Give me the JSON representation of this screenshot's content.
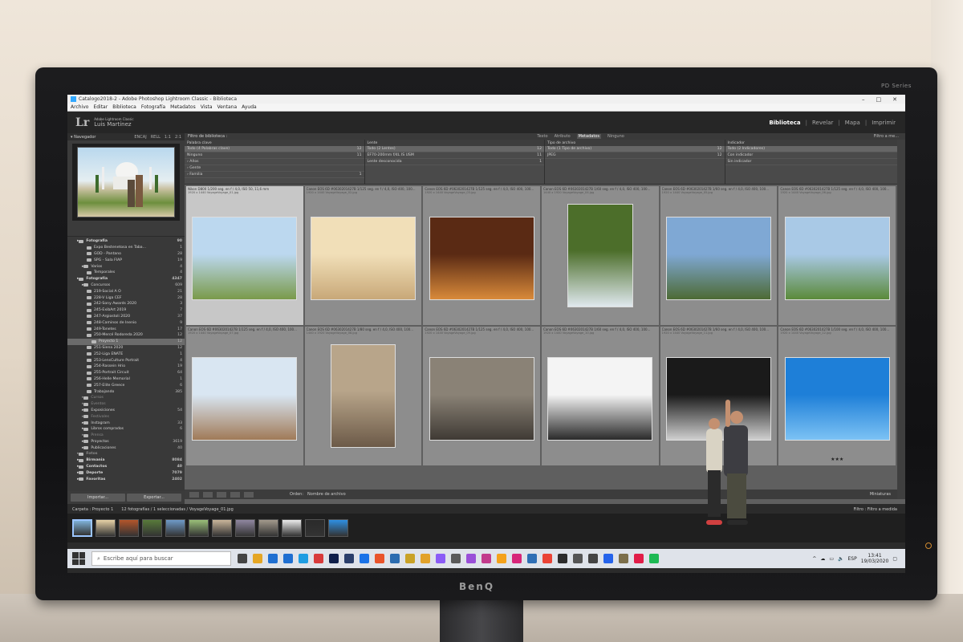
{
  "window": {
    "title": "Catalogo2018-2 - Adobe Photoshop Lightroom Classic - Biblioteca",
    "menus": [
      "Archivo",
      "Editar",
      "Biblioteca",
      "Fotografía",
      "Metadatos",
      "Vista",
      "Ventana",
      "Ayuda"
    ]
  },
  "identity": {
    "app": "Adobe Lightroom Classic",
    "user": "Luis Martínez",
    "logo": "Lr"
  },
  "modules": [
    "Biblioteca",
    "Revelar",
    "Mapa",
    "Imprimir"
  ],
  "navigator": {
    "title": "Navegador",
    "zooms": [
      "ENCAJ",
      "RELL",
      "1:1",
      "2:1"
    ]
  },
  "folders": [
    {
      "name": "Fotografia",
      "count": "90",
      "level": 1
    },
    {
      "name": "Expo Bestenetosa en Taba...",
      "count": "1",
      "level": 3
    },
    {
      "name": "GOD - Pantano",
      "count": "28",
      "level": 3
    },
    {
      "name": "SPG - Sala FIAP",
      "count": "19",
      "level": 3
    },
    {
      "name": "Varios",
      "count": "4",
      "level": 2
    },
    {
      "name": "Temporales",
      "count": "4",
      "level": 3
    },
    {
      "name": "Fotografía",
      "count": "4347",
      "level": 1
    },
    {
      "name": "Concursos",
      "count": "609",
      "level": 2
    },
    {
      "name": "219-Social A O",
      "count": "21",
      "level": 3
    },
    {
      "name": "228-V Liga CEF",
      "count": "28",
      "level": 3
    },
    {
      "name": "242-Sony Awards 2020",
      "count": "3",
      "level": 3
    },
    {
      "name": "245-ExibArt 2019",
      "count": "7",
      "level": 3
    },
    {
      "name": "247-Argiostoli 2020",
      "count": "37",
      "level": 3
    },
    {
      "name": "248-Caminos de Inenio",
      "count": "9",
      "level": 3
    },
    {
      "name": "249-Tonetes",
      "count": "17",
      "level": 3
    },
    {
      "name": "250-Mercé Rodoreda 2020",
      "count": "12",
      "level": 3
    },
    {
      "name": "Proyecto 1",
      "count": "12",
      "level": 4,
      "selected": true
    },
    {
      "name": "251-Siena 2020",
      "count": "12",
      "level": 3
    },
    {
      "name": "252-Liga ENATE",
      "count": "1",
      "level": 3
    },
    {
      "name": "253-LensCulture Portrait",
      "count": "4",
      "level": 3
    },
    {
      "name": "254-Rassein Hrio",
      "count": "19",
      "level": 3
    },
    {
      "name": "255-Portrait Circuit",
      "count": "64",
      "level": 3
    },
    {
      "name": "256-Helle Memorial",
      "count": "1",
      "level": 3
    },
    {
      "name": "257-Elite Greece",
      "count": "6",
      "level": 3
    },
    {
      "name": "Trabajando",
      "count": "385",
      "level": 3
    },
    {
      "name": "Cursos",
      "count": "",
      "level": 2,
      "dim": true
    },
    {
      "name": "Eventos",
      "count": "",
      "level": 2,
      "dim": true
    },
    {
      "name": "Exposiciones",
      "count": "54",
      "level": 2
    },
    {
      "name": "Festivales",
      "count": "",
      "level": 2,
      "dim": true
    },
    {
      "name": "Instagram",
      "count": "33",
      "level": 2
    },
    {
      "name": "Libros comprados",
      "count": "6",
      "level": 2
    },
    {
      "name": "Prensa",
      "count": "",
      "level": 2,
      "dim": true
    },
    {
      "name": "Proyectos",
      "count": "3619",
      "level": 2
    },
    {
      "name": "Publicaciones",
      "count": "40",
      "level": 2
    },
    {
      "name": "Fotos",
      "count": "",
      "level": 1,
      "dim": true
    },
    {
      "name": "Birmania",
      "count": "8084",
      "level": 1
    },
    {
      "name": "Contactos",
      "count": "40",
      "level": 1
    },
    {
      "name": "Deporte",
      "count": "7079",
      "level": 1
    },
    {
      "name": "Favoritas",
      "count": "2402",
      "level": 1
    }
  ],
  "left_buttons": {
    "import": "Importar...",
    "export": "Exportar..."
  },
  "filter": {
    "title": "Filtro de biblioteca :",
    "tabs": [
      "Texto",
      "Atributo",
      "Metadatos",
      "Ninguno"
    ],
    "preset": "Filtro a me...",
    "columns": [
      {
        "header": "Palabra clave",
        "rows": [
          {
            "label": "Todo (4 Palabras clave)",
            "value": "12",
            "hl": true
          },
          {
            "label": "Ninguno",
            "value": "11"
          },
          {
            "label": "› Años",
            "value": ""
          },
          {
            "label": "› Gente",
            "value": ""
          },
          {
            "label": "  › Familia",
            "value": "1"
          }
        ]
      },
      {
        "header": "Lente",
        "rows": [
          {
            "label": "Todo (2 Lentes)",
            "value": "12",
            "hl": true
          },
          {
            "label": "EF70-200mm f/4L IS USM",
            "value": "11"
          },
          {
            "label": "Lente desconocida",
            "value": "1"
          }
        ]
      },
      {
        "header": "Tipo de archivo",
        "rows": [
          {
            "label": "Todo (1 Tipo de archivo)",
            "value": "12",
            "hl": true
          },
          {
            "label": "JPEG",
            "value": "12"
          }
        ]
      },
      {
        "header": "Indicador",
        "rows": [
          {
            "label": "Todo (2 Indicadores)",
            "value": "12",
            "hl": true
          },
          {
            "label": "Con indicador",
            "value": "0"
          },
          {
            "label": "Sin indicador",
            "value": "12"
          }
        ]
      }
    ]
  },
  "grid": [
    {
      "cap": "Nikon D800    1/200 seg. en f / 4,0, ISO 50, 11,6 mm",
      "file": "1920 x 1440    VoyageVoyage_01.jpg",
      "sel": true,
      "c1": "#bcd8ef",
      "c2": "#7a9a4a",
      "stars": ""
    },
    {
      "cap": "Canon EOS 6D #0630201427B   1/125 seg. en f / 4,0, ISO 400, 100...",
      "file": "1920 x 1440    VoyageVoyage_02.jpg",
      "c1": "#f1dfb8",
      "c2": "#c8a878",
      "stars": ""
    },
    {
      "cap": "Canon EOS 6D #0630201427B   1/125 seg. en f / 4,0, ISO 400, 100...",
      "file": "1920 x 1440    VoyageVoyage_03.jpg",
      "c1": "#5a2a14",
      "c2": "#d98a3a",
      "stars": ""
    },
    {
      "cap": "Canon EOS 6D #0630201427B   1/60 seg. en f / 4,0, ISO 400, 100...",
      "file": "1440 x 1920    VoyageVoyage_04.jpg",
      "c1": "#4c6e2a",
      "c2": "#dfe8ee",
      "stars": ""
    },
    {
      "cap": "Canon EOS 6D #0630201427B   1/60 seg. en f / 4,0, ISO 400, 100...",
      "file": "1920 x 1440    VoyageVoyage_05.jpg",
      "c1": "#7fa8d4",
      "c2": "#4d6a34",
      "stars": ""
    },
    {
      "cap": "Canon EOS 6D #0630201427B   1/125 seg. en f / 4,0, ISO 400, 100...",
      "file": "1920 x 1440    VoyageVoyage_06.jpg",
      "c1": "#a9c9e6",
      "c2": "#5b8a3a",
      "stars": ""
    },
    {
      "cap": "Canon EOS 6D #0630201427B   1/125 seg. en f / 4,0, ISO 400, 100...",
      "file": "1920 x 1440    VoyageVoyage_07.jpg",
      "c1": "#d9e6f2",
      "c2": "#a07a58",
      "stars": ""
    },
    {
      "cap": "Canon EOS 6D #0630201427B   1/80 seg. en f / 4,0, ISO 400, 100...",
      "file": "1440 x 1920    VoyageVoyage_08.jpg",
      "c1": "#b8a58a",
      "c2": "#6c5a48",
      "stars": ""
    },
    {
      "cap": "Canon EOS 6D #0630201427B   1/125 seg. en f / 4,0, ISO 400, 100...",
      "file": "1920 x 1440    VoyageVoyage_09.jpg",
      "c1": "#8a8276",
      "c2": "#3f3a34",
      "stars": ""
    },
    {
      "cap": "Canon EOS 6D #0630201427B   1/60 seg. en f / 4,0, ISO 400, 100...",
      "file": "1920 x 1440    VoyageVoyage_10.jpg",
      "c1": "#f4f4f4",
      "c2": "#2a2a2a",
      "stars": ""
    },
    {
      "cap": "Canon EOS 6D #0630201427B   1/60 seg. en f / 4,0, ISO 400, 100...",
      "file": "1920 x 1440    VoyageVoyage_11.jpg",
      "c1": "#1a1a1a",
      "c2": "#cfcfcf",
      "stars": ""
    },
    {
      "cap": "Canon EOS 6D #0630201427B   1/100 seg. en f / 4,0, ISO 400, 100...",
      "file": "1920 x 1440    VoyageVoyage_12.jpg",
      "c1": "#1e7fd8",
      "c2": "#7cc2f4",
      "stars": "★★★"
    }
  ],
  "toolbar": {
    "sort_label": "Orden:",
    "sort_value": "Nombre de archivo",
    "thumbs": "Miniaturas"
  },
  "filmstrip": {
    "source": "Carpeta : Proyecto 1",
    "summary": "12 fotografías / 1 seleccionadas / VoyageVoyage_01.jpg",
    "filter_label": "Filtro :",
    "filter_value": "Filtro a medida",
    "thumbs": [
      "#7fb1d8",
      "#e7d2a6",
      "#b3552a",
      "#587a3a",
      "#6e9ac8",
      "#9abf78",
      "#c9b59a",
      "#8f86a0",
      "#a39a8c",
      "#ececec",
      "#2a2a2a",
      "#2e8fe2"
    ]
  },
  "taskbar": {
    "search": "Escribe aquí para buscar",
    "lang": "ESP",
    "time": "13:41",
    "date": "19/03/2020",
    "icons": [
      "#444",
      "#e5a624",
      "#1f6fd1",
      "#1f6fd1",
      "#1f9de2",
      "#d83b3b",
      "#0f1f4a",
      "#2b3f6b",
      "#1a73e8",
      "#e9542b",
      "#2b6cb0",
      "#c9a227",
      "#e2a22a",
      "#8b5cf6",
      "#5a5a5a",
      "#9a4fd8",
      "#c23b8c",
      "#f4a21b",
      "#d7267a",
      "#2f6fb5",
      "#ea4335",
      "#2c2c2c",
      "#555",
      "#444",
      "#2563eb",
      "#7c6f4b",
      "#e11d48",
      "#1db954"
    ]
  },
  "monitor": {
    "brand": "BenQ",
    "series": "PD Series"
  }
}
